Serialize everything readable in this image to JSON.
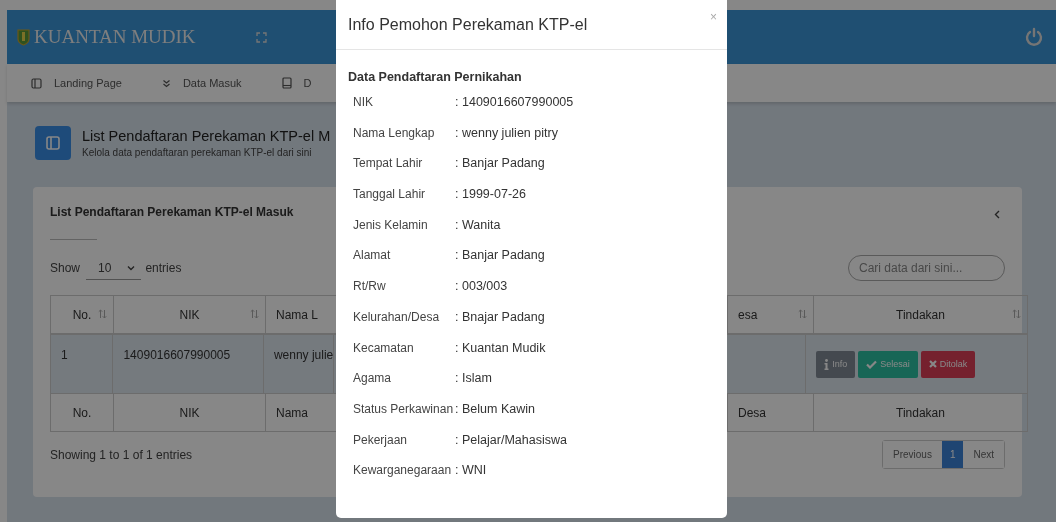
{
  "header": {
    "brand": "KUANTAN MUDIK"
  },
  "nav": [
    {
      "label": "Landing Page",
      "kind": "layout"
    },
    {
      "label": "Data Masuk",
      "kind": "chevrons"
    },
    {
      "label": "D",
      "kind": "book"
    }
  ],
  "page": {
    "title": "List Pendaftaran Perekaman KTP-el M",
    "subtitle": "Kelola data pendaftaran perekaman KTP-el dari sini"
  },
  "card": {
    "title": "List Pendaftaran Perekaman KTP-el Masuk",
    "show_label": "Show",
    "page_size": "10",
    "entries_label": "entries",
    "search": {
      "placeholder": "Cari data dari sini..."
    }
  },
  "table": {
    "columns": [
      {
        "label": "No.",
        "sortable": true
      },
      {
        "label": "NIK",
        "sortable": true
      },
      {
        "label": "Nama L",
        "sortable": false
      },
      {
        "label": "esa",
        "sortable": true
      },
      {
        "label": "Tindakan",
        "sortable": true
      }
    ],
    "rows": [
      {
        "cells": [
          "1",
          "1409016607990005",
          "wenny julie"
        ],
        "actions": [
          {
            "kind": "info",
            "label": "Info"
          },
          {
            "kind": "done",
            "label": "Selesai"
          },
          {
            "kind": "reject",
            "label": "Ditolak"
          }
        ]
      }
    ],
    "footer": [
      "No.",
      "NIK",
      "Nama",
      "Desa",
      "Tindakan"
    ]
  },
  "info": "Showing 1 to 1 of 1 entries",
  "pagination": [
    {
      "label": "Previous",
      "selected": false
    },
    {
      "label": "1",
      "selected": true
    },
    {
      "label": "Next",
      "selected": false
    }
  ],
  "modal": {
    "title": "Info Pemohon Perekaman KTP-el",
    "close": "×",
    "section": "Data Pendaftaran Pernikahan",
    "fields": [
      {
        "label": "NIK",
        "value": ": 1409016607990005"
      },
      {
        "label": "Nama Lengkap",
        "value": ": wenny julien pitry"
      },
      {
        "label": "Tempat Lahir",
        "value": ": Banjar Padang"
      },
      {
        "label": "Tanggal Lahir",
        "value": ": 1999-07-26"
      },
      {
        "label": "Jenis Kelamin",
        "value": ": Wanita"
      },
      {
        "label": "Alamat",
        "value": ": Banjar Padang"
      },
      {
        "label": "Rt/Rw",
        "value": ": 003/003"
      },
      {
        "label": "Kelurahan/Desa",
        "value": ": Bnajar Padang"
      },
      {
        "label": "Kecamatan",
        "value": ": Kuantan Mudik"
      },
      {
        "label": "Agama",
        "value": ": Islam"
      },
      {
        "label": "Status Perkawinan",
        "value": ": Belum Kawin"
      },
      {
        "label": "Pekerjaan",
        "value": ": Pelajar/Mahasiswa"
      },
      {
        "label": "Kewarganegaraan",
        "value": ": WNI"
      }
    ]
  }
}
